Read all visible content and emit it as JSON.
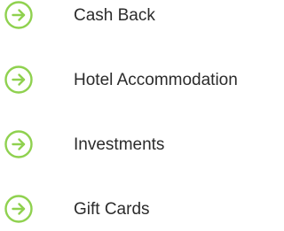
{
  "accent_color": "#8fd14f",
  "text_color": "#2b2b2b",
  "items": [
    {
      "label": "Cash Back",
      "icon": "arrow-right-circle-icon"
    },
    {
      "label": "Hotel Accommodation",
      "icon": "arrow-right-circle-icon"
    },
    {
      "label": "Investments",
      "icon": "arrow-right-circle-icon"
    },
    {
      "label": "Gift Cards",
      "icon": "arrow-right-circle-icon"
    }
  ]
}
